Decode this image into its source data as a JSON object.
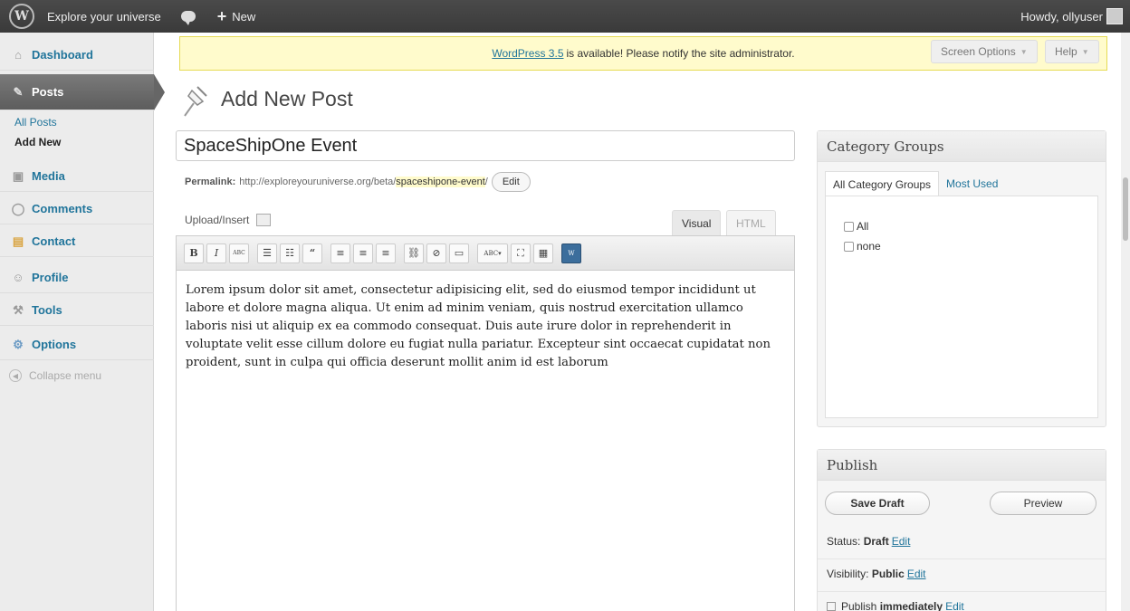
{
  "adminbar": {
    "site_name": "Explore your universe",
    "new_label": "New",
    "howdy": "Howdy, ollyuser"
  },
  "sidebar": {
    "items": [
      {
        "label": "Dashboard",
        "icon": "dashboard-icon"
      },
      {
        "label": "Posts",
        "icon": "pin-icon"
      },
      {
        "label": "Media",
        "icon": "media-icon"
      },
      {
        "label": "Comments",
        "icon": "comments-icon"
      },
      {
        "label": "Contact",
        "icon": "contact-icon"
      },
      {
        "label": "Profile",
        "icon": "profile-icon"
      },
      {
        "label": "Tools",
        "icon": "tools-icon"
      },
      {
        "label": "Options",
        "icon": "options-icon"
      }
    ],
    "submenu": [
      "All Posts",
      "Add New"
    ],
    "collapse": "Collapse menu"
  },
  "notice": {
    "link": "WordPress 3.5",
    "text": "is available! Please notify the site administrator."
  },
  "screen_options": "Screen Options",
  "help": "Help",
  "page_title": "Add New Post",
  "post_title": "SpaceShipOne Event",
  "permalink": {
    "label": "Permalink:",
    "base": "http://exploreyouruniverse.org/beta/",
    "slug": "spaceshipone-event",
    "trail": "/",
    "edit": "Edit"
  },
  "upload_insert": "Upload/Insert",
  "editor_tabs": {
    "visual": "Visual",
    "html": "HTML"
  },
  "toolbar_buttons": [
    "B",
    "I",
    "ABC",
    "ul",
    "ol",
    "66",
    "al",
    "ac",
    "ar",
    "link",
    "unlink",
    "more",
    "ABC",
    "fs",
    "kb",
    "wd"
  ],
  "content": "Lorem ipsum dolor sit amet, consectetur adipisicing elit, sed do eiusmod tempor incididunt ut labore et dolore magna aliqua. Ut enim ad minim veniam, quis nostrud exercitation ullamco laboris nisi ut aliquip ex ea commodo consequat. Duis aute irure dolor in reprehenderit in voluptate velit esse cillum dolore eu fugiat nulla pariatur. Excepteur sint occaecat cupidatat non proident, sunt in culpa qui officia deserunt mollit anim id est laborum",
  "category_groups": {
    "title": "Category Groups",
    "tab_all": "All Category Groups",
    "tab_used": "Most Used",
    "options": [
      "All",
      "none"
    ]
  },
  "publish": {
    "title": "Publish",
    "save_draft": "Save Draft",
    "preview": "Preview",
    "status_label": "Status:",
    "status_value": "Draft",
    "visibility_label": "Visibility:",
    "visibility_value": "Public",
    "publish_label": "Publish",
    "publish_value": "immediately",
    "edit": "Edit"
  },
  "colors": {
    "link": "#21759b",
    "notice_bg": "#fffbcc",
    "adminbar": "#464646"
  }
}
